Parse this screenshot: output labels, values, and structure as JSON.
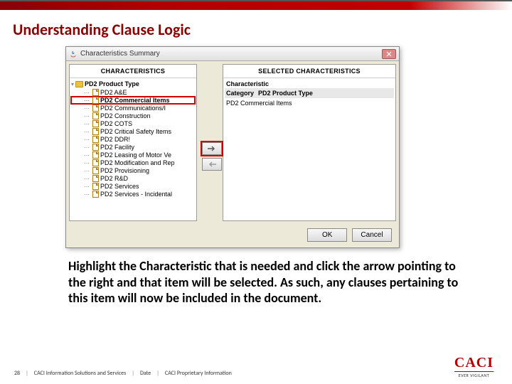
{
  "page_title": "Understanding Clause Logic",
  "dialog": {
    "title": "Characteristics Summary",
    "left_header": "CHARACTERISTICS",
    "right_header": "SELECTED CHARACTERISTICS",
    "root_label": "PD2 Product Type",
    "items": [
      "PD2 A&E",
      "PD2 Commercial Items",
      "PD2 Communications/I",
      "PD2 Construction",
      "PD2 COTS",
      "PD2 Critical Safety Items",
      "PD2 DDR!",
      "PD2 Facility",
      "PD2 Leasing of Motor Ve",
      "PD2 Modification and Rep",
      "PD2 Provisioning",
      "PD2 R&D",
      "PD2 Services",
      "PD2 Services - Incidental"
    ],
    "right": {
      "char_label": "Characteristic",
      "cat_label": "Category",
      "cat_value": "PD2 Product Type",
      "selected_item": "PD2 Commercial Items"
    },
    "ok_label": "OK",
    "cancel_label": "Cancel"
  },
  "instruction_text": "Highlight the Characteristic that is needed and click the arrow pointing to the right and that item will be selected.  As such, any clauses pertaining to this item will now be included in the document.",
  "footer": {
    "page_num": "28",
    "org": "CACI Information Solutions and Services",
    "date_label": "Date",
    "prop": "CACI Proprietary Information",
    "brand": "CACI",
    "tagline": "EVER VIGILANT"
  }
}
